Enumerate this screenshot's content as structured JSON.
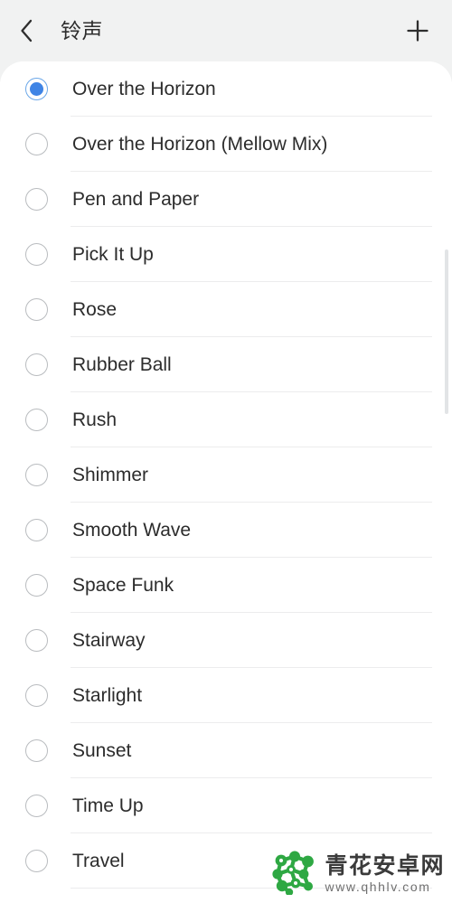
{
  "header": {
    "title": "铃声",
    "back_icon": "chevron-left-icon",
    "add_icon": "plus-icon"
  },
  "list": {
    "selected_index": 0,
    "items": [
      {
        "label": "Over the Horizon",
        "selected": true
      },
      {
        "label": "Over the Horizon (Mellow Mix)",
        "selected": false
      },
      {
        "label": "Pen and Paper",
        "selected": false
      },
      {
        "label": "Pick It Up",
        "selected": false
      },
      {
        "label": "Rose",
        "selected": false
      },
      {
        "label": "Rubber Ball",
        "selected": false
      },
      {
        "label": "Rush",
        "selected": false
      },
      {
        "label": "Shimmer",
        "selected": false
      },
      {
        "label": "Smooth Wave",
        "selected": false
      },
      {
        "label": "Space Funk",
        "selected": false
      },
      {
        "label": "Stairway",
        "selected": false
      },
      {
        "label": "Starlight",
        "selected": false
      },
      {
        "label": "Sunset",
        "selected": false
      },
      {
        "label": "Time Up",
        "selected": false
      },
      {
        "label": "Travel",
        "selected": false
      }
    ]
  },
  "watermark": {
    "title": "青花安卓网",
    "url": "www.qhhlv.com",
    "logo_icon": "molecule-network-logo-icon",
    "logo_color": "#2ea843"
  },
  "colors": {
    "page_background": "#f1f2f2",
    "card_background": "#ffffff",
    "accent": "#3f84e5",
    "accent_ring": "#6ba7e8",
    "radio_border": "#b9bcbf",
    "divider": "#ececed",
    "text_primary": "#2c2c2c",
    "title_text": "#2e2e2e",
    "scrollbar_thumb": "#e2e4e6"
  },
  "scrollbar": {
    "visible": true
  }
}
